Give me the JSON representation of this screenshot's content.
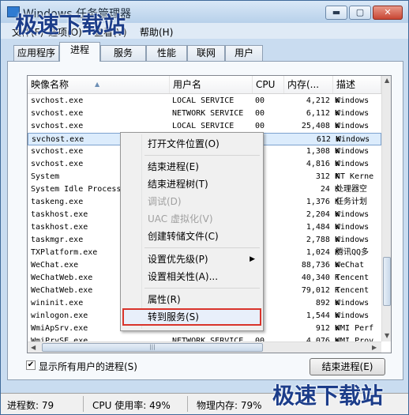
{
  "window": {
    "title": "Windows 任务管理器",
    "buttons": {
      "minimize": "▬",
      "maximize": "▢",
      "close": "✕"
    }
  },
  "menu": [
    "文件(F)",
    "选项(O)",
    "查看(V)",
    "帮助(H)"
  ],
  "watermark": {
    "top": "极速下载站",
    "bottom": "极速下载站"
  },
  "tabs": [
    "应用程序",
    "进程",
    "服务",
    "性能",
    "联网",
    "用户"
  ],
  "active_tab": "进程",
  "columns": [
    "映像名称",
    "用户名",
    "CPU",
    "内存(...",
    "描述"
  ],
  "processes": [
    {
      "name": "svchost.exe",
      "user": "LOCAL SERVICE",
      "cpu": "00",
      "mem": "4,212 K",
      "desc": "Windows"
    },
    {
      "name": "svchost.exe",
      "user": "NETWORK SERVICE",
      "cpu": "00",
      "mem": "6,112 K",
      "desc": "Windows"
    },
    {
      "name": "svchost.exe",
      "user": "LOCAL SERVICE",
      "cpu": "00",
      "mem": "25,408 K",
      "desc": "Windows"
    },
    {
      "name": "svchost.exe",
      "user": "",
      "cpu": "",
      "mem": "612 K",
      "desc": "Windows"
    },
    {
      "name": "svchost.exe",
      "user": "",
      "cpu": "",
      "mem": "1,308 K",
      "desc": "Windows"
    },
    {
      "name": "svchost.exe",
      "user": "",
      "cpu": "",
      "mem": "4,816 K",
      "desc": "Windows"
    },
    {
      "name": "System",
      "user": "",
      "cpu": "",
      "mem": "312 K",
      "desc": "NT Kerne"
    },
    {
      "name": "System Idle Process",
      "user": "",
      "cpu": "",
      "mem": "24 K",
      "desc": "处理器空"
    },
    {
      "name": "taskeng.exe",
      "user": "",
      "cpu": "",
      "mem": "1,376 K",
      "desc": "任务计划"
    },
    {
      "name": "taskhost.exe",
      "user": "",
      "cpu": "",
      "mem": "2,204 K",
      "desc": "Windows"
    },
    {
      "name": "taskhost.exe",
      "user": "",
      "cpu": "",
      "mem": "1,484 K",
      "desc": "Windows"
    },
    {
      "name": "taskmgr.exe",
      "user": "",
      "cpu": "",
      "mem": "2,788 K",
      "desc": "Windows"
    },
    {
      "name": "TXPlatform.exe",
      "user": "",
      "cpu": "",
      "mem": "1,024 K",
      "desc": "腾讯QQ多"
    },
    {
      "name": "WeChat.exe",
      "user": "",
      "cpu": "",
      "mem": "88,736 K",
      "desc": "WeChat"
    },
    {
      "name": "WeChatWeb.exe",
      "user": "",
      "cpu": "",
      "mem": "40,340 K",
      "desc": "Tencent"
    },
    {
      "name": "WeChatWeb.exe",
      "user": "",
      "cpu": "",
      "mem": "79,012 K",
      "desc": "Tencent"
    },
    {
      "name": "wininit.exe",
      "user": "",
      "cpu": "",
      "mem": "892 K",
      "desc": "Windows"
    },
    {
      "name": "winlogon.exe",
      "user": "",
      "cpu": "",
      "mem": "1,544 K",
      "desc": "Windows"
    },
    {
      "name": "WmiApSrv.exe",
      "user": "",
      "cpu": "",
      "mem": "912 K",
      "desc": "WMI Perf"
    },
    {
      "name": "WmiPrvSE.exe",
      "user": "NETWORK SERVICE",
      "cpu": "00",
      "mem": "4,076 K",
      "desc": "WMI Prov"
    }
  ],
  "context_menu": [
    {
      "label": "打开文件位置(O)",
      "disabled": false
    },
    {
      "sep": true
    },
    {
      "label": "结束进程(E)",
      "disabled": false
    },
    {
      "label": "结束进程树(T)",
      "disabled": false
    },
    {
      "label": "调试(D)",
      "disabled": true
    },
    {
      "label": "UAC 虚拟化(V)",
      "disabled": true
    },
    {
      "label": "创建转储文件(C)",
      "disabled": false
    },
    {
      "sep": true
    },
    {
      "label": "设置优先级(P)",
      "disabled": false,
      "submenu": true
    },
    {
      "label": "设置相关性(A)...",
      "disabled": false
    },
    {
      "sep": true
    },
    {
      "label": "属性(R)",
      "disabled": false
    },
    {
      "label": "转到服务(S)",
      "disabled": false,
      "highlighted": true
    }
  ],
  "show_all_users": {
    "label": "显示所有用户的进程(S)",
    "checked": true
  },
  "end_process_button": "结束进程(E)",
  "status": {
    "processes": "进程数: 79",
    "cpu": "CPU 使用率: 49%",
    "memory": "物理内存: 79%"
  }
}
